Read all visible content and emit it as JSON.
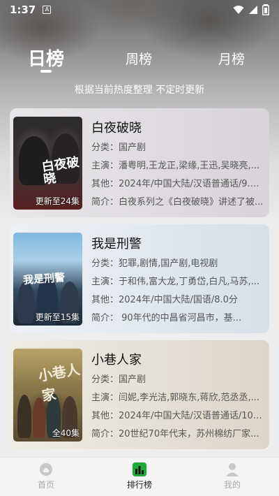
{
  "status": {
    "time": "1:37",
    "a_badge": "A"
  },
  "tabs": [
    {
      "label": "日榜",
      "active": true
    },
    {
      "label": "周榜",
      "active": false
    },
    {
      "label": "月榜",
      "active": false
    }
  ],
  "subtitle": "根据当前热度整理 不定时更新",
  "cards": [
    {
      "title": "白夜破晓",
      "poster_text": "白夜破晓",
      "badge": "更新至24集",
      "category": "分类：国产剧",
      "cast": "主演：潘粤明,王龙正,梁缘,王迅,吴晓亮,...",
      "other": "其他：2024年/中国大陆/汉语普通话/9.7...",
      "intro": "简介：白夜系列之《白夜破晓》讲述了被..."
    },
    {
      "title": "我是刑警",
      "poster_text": "我是刑警",
      "badge": "更新至15集",
      "category": "分类：犯罪,剧情,国产剧,电视剧",
      "cast": "主演：于和伟,富大龙,丁勇岱,白凡,马苏,...",
      "other": "其他：2024年/中国大陆/国语/8.0分",
      "intro": "简介：       90年代的中昌省河昌市，基..."
    },
    {
      "title": "小巷人家",
      "poster_text": "小巷人家",
      "badge": "全40集",
      "category": "分类：国产剧",
      "cast": "主演：闫妮,李光洁,郭晓东,蒋欣,范丞丞,...",
      "other": "其他：2024年/中国大陆/汉语普通话/10....",
      "intro": "简介：20世纪70年代末，苏州棉纺厂家..."
    }
  ],
  "nav": [
    {
      "label": "首页",
      "icon": "home-icon"
    },
    {
      "label": "排行榜",
      "icon": "ranking-icon"
    },
    {
      "label": "我的",
      "icon": "profile-icon"
    }
  ],
  "colors": {
    "active_nav": "#1faa3a",
    "text": "#555555"
  }
}
